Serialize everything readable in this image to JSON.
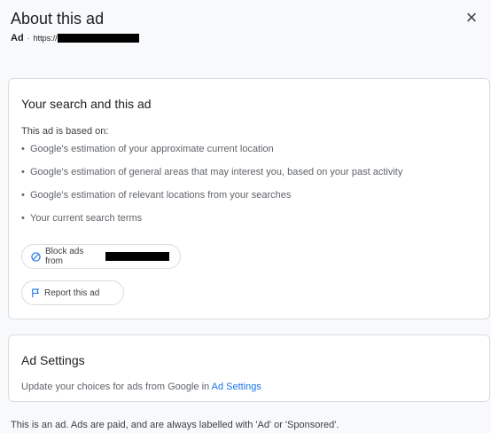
{
  "header": {
    "title": "About this ad",
    "ad_label": "Ad",
    "separator": "·",
    "url_prefix": "https://",
    "close_glyph": "×"
  },
  "search_card": {
    "heading": "Your search and this ad",
    "intro": "This ad is based on:",
    "reasons": [
      "Google's estimation of your approximate current location",
      "Google's estimation of general areas that may interest you, based on your past activity",
      "Google's estimation of relevant locations from your searches",
      "Your current search terms"
    ],
    "block_label": "Block ads from",
    "report_label": "Report this ad"
  },
  "settings_card": {
    "heading": "Ad Settings",
    "text": "Update your choices for ads from Google in",
    "link": "Ad Settings"
  },
  "footer": {
    "text": "This is an ad. Ads are paid, and are always labelled with 'Ad' or 'Sponsored'."
  },
  "icons": {
    "close": "close-icon",
    "block": "block-icon",
    "report": "flag-icon"
  },
  "colors": {
    "accent": "#1a73e8",
    "background": "#f8f9fa",
    "card_border": "#dadce0"
  }
}
